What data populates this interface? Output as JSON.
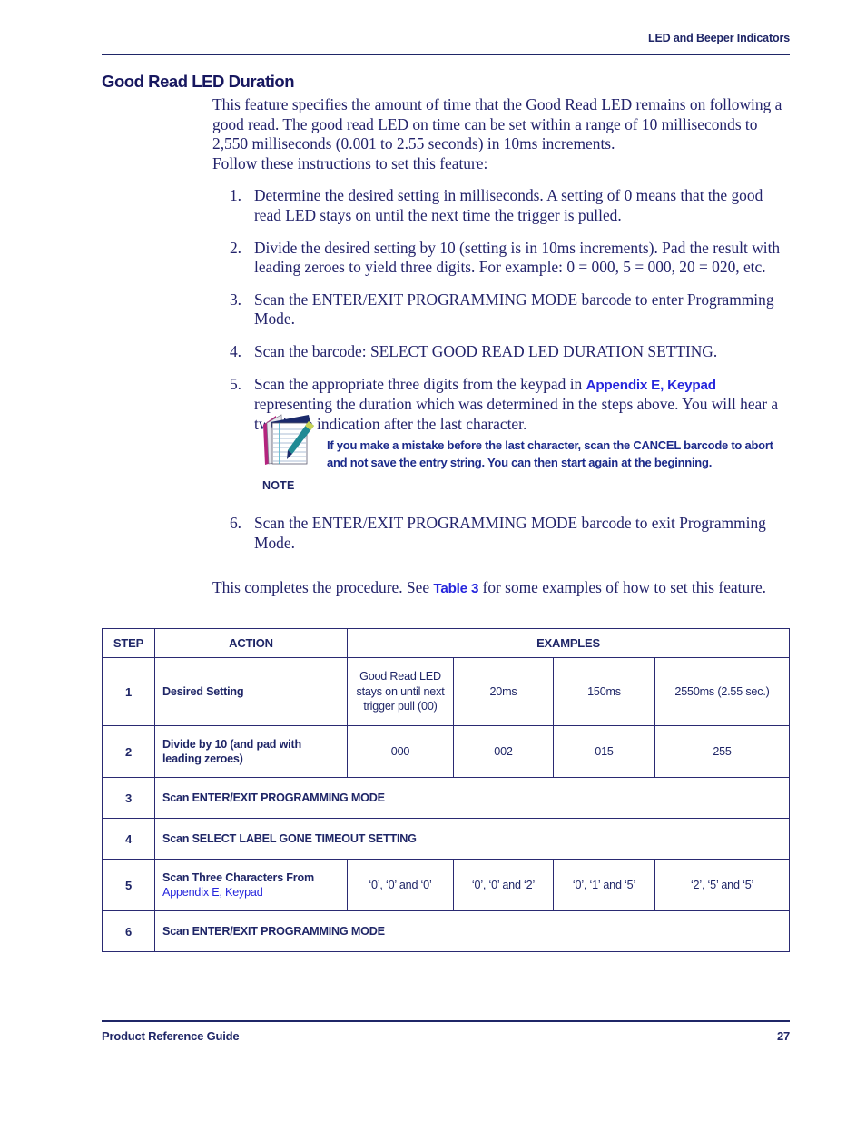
{
  "document": {
    "header_text": "LED and Beeper Indicators",
    "footer_left": "Product Reference Guide",
    "footer_page": "27"
  },
  "section": {
    "heading": "Good Read LED Duration"
  },
  "intro": {
    "para1": "This feature specifies the amount of time that the Good Read LED remains on following a good read. The good read LED on time can be set within a range of 10 milliseconds to 2,550 milliseconds (0.001 to 2.55 seconds) in 10ms increments.",
    "para2": "Follow these instructions to set this feature:"
  },
  "steps": [
    {
      "num": "1.",
      "text": "Determine the desired setting in milliseconds. A setting of 0 means that the good read LED stays on until the next time the trigger is pulled."
    },
    {
      "num": "2.",
      "text": "Divide the desired setting by 10 (setting is in 10ms increments). Pad the result with leading zeroes to yield three digits. For example: 0 = 000, 5 = 000, 20 = 020, etc."
    },
    {
      "num": "3.",
      "text": "Scan the ENTER/EXIT PROGRAMMING MODE barcode to enter Programming Mode."
    },
    {
      "num": "4.",
      "text": "Scan the barcode: SELECT GOOD READ LED DURATION SETTING."
    },
    {
      "num": "5.",
      "text_before": "Scan the appropriate three digits from the keypad in ",
      "link": "Appendix E, Keypad",
      "text_after": " representing the duration which was determined in the steps above. You will hear a two-beep indication after the last character."
    },
    {
      "num": "6.",
      "text": "Scan the ENTER/EXIT PROGRAMMING MODE barcode to exit Programming Mode."
    }
  ],
  "note": {
    "label": "NOTE",
    "icon": "notepad-pen-icon",
    "text": "If you make a mistake before the last character, scan the CANCEL barcode to abort and not save the entry string. You can then start again at the beginning."
  },
  "closing": {
    "text_before": "This completes the procedure. See ",
    "link": "Table 3",
    "text_after": " for some examples of how to set this feature."
  },
  "table": {
    "headers": [
      "STEP",
      "ACTION",
      "EXAMPLES"
    ],
    "rows": [
      {
        "step": "1",
        "action": "Desired Setting",
        "action_link": "",
        "examples": [
          "Good Read LED stays on until next trigger pull (00)",
          "20ms",
          "150ms",
          "2550ms (2.55 sec.)"
        ],
        "span": false
      },
      {
        "step": "2",
        "action": "Divide by 10 (and pad with leading zeroes)",
        "action_link": "",
        "examples": [
          "000",
          "002",
          "015",
          "255"
        ],
        "span": false
      },
      {
        "step": "3",
        "action": "Scan ENTER/EXIT PROGRAMMING MODE",
        "action_link": "",
        "examples": [],
        "span": true
      },
      {
        "step": "4",
        "action": "Scan SELECT LABEL GONE TIMEOUT SETTING",
        "action_link": "",
        "examples": [],
        "span": true
      },
      {
        "step": "5",
        "action": "Scan Three Characters From",
        "action_link": "Appendix E, Keypad",
        "examples": [
          "‘0’, ‘0’ and ‘0’",
          "‘0’, ‘0’ and ‘2’",
          "‘0’, ‘1’ and ‘5’",
          "‘2’, ‘5’ and ‘5’"
        ],
        "span": false
      },
      {
        "step": "6",
        "action": "Scan ENTER/EXIT PROGRAMMING MODE",
        "action_link": "",
        "examples": [],
        "span": true
      }
    ]
  },
  "colors": {
    "body_text": "#23236b",
    "heading": "#17175f",
    "link": "#2626dd",
    "rule": "#1f2667",
    "table_border": "#2a2a72"
  }
}
